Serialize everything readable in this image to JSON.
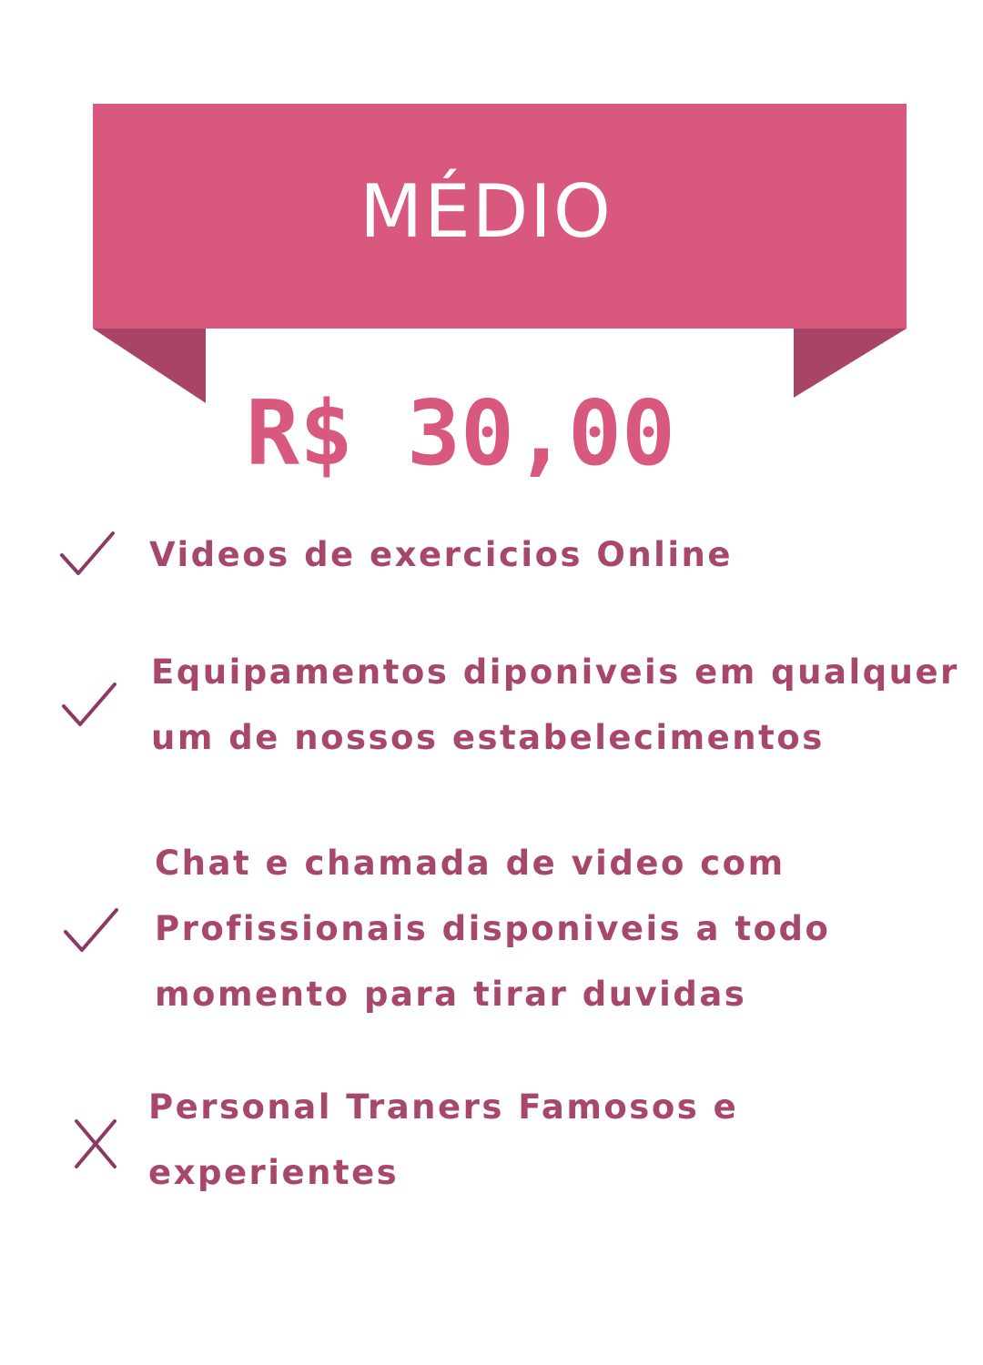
{
  "plan": {
    "title": "MÉDIO",
    "price": "R$ 30,00"
  },
  "colors": {
    "banner": "#d9587e",
    "fold": "#a84566",
    "text": "#a8476c",
    "icon": "#8c3a64"
  },
  "features": [
    {
      "included": true,
      "icon": "check-icon",
      "lines": [
        "Videos de exercicios Online"
      ]
    },
    {
      "included": true,
      "icon": "check-icon",
      "lines": [
        "Equipamentos diponiveis em qualquer",
        "um de nossos estabelecimentos"
      ]
    },
    {
      "included": true,
      "icon": "check-icon",
      "lines": [
        "Chat e chamada de video com",
        "Profissionais disponiveis a todo",
        "momento para tirar duvidas"
      ]
    },
    {
      "included": false,
      "icon": "cross-icon",
      "lines": [
        "Personal Traners Famosos e",
        "experientes"
      ]
    }
  ]
}
